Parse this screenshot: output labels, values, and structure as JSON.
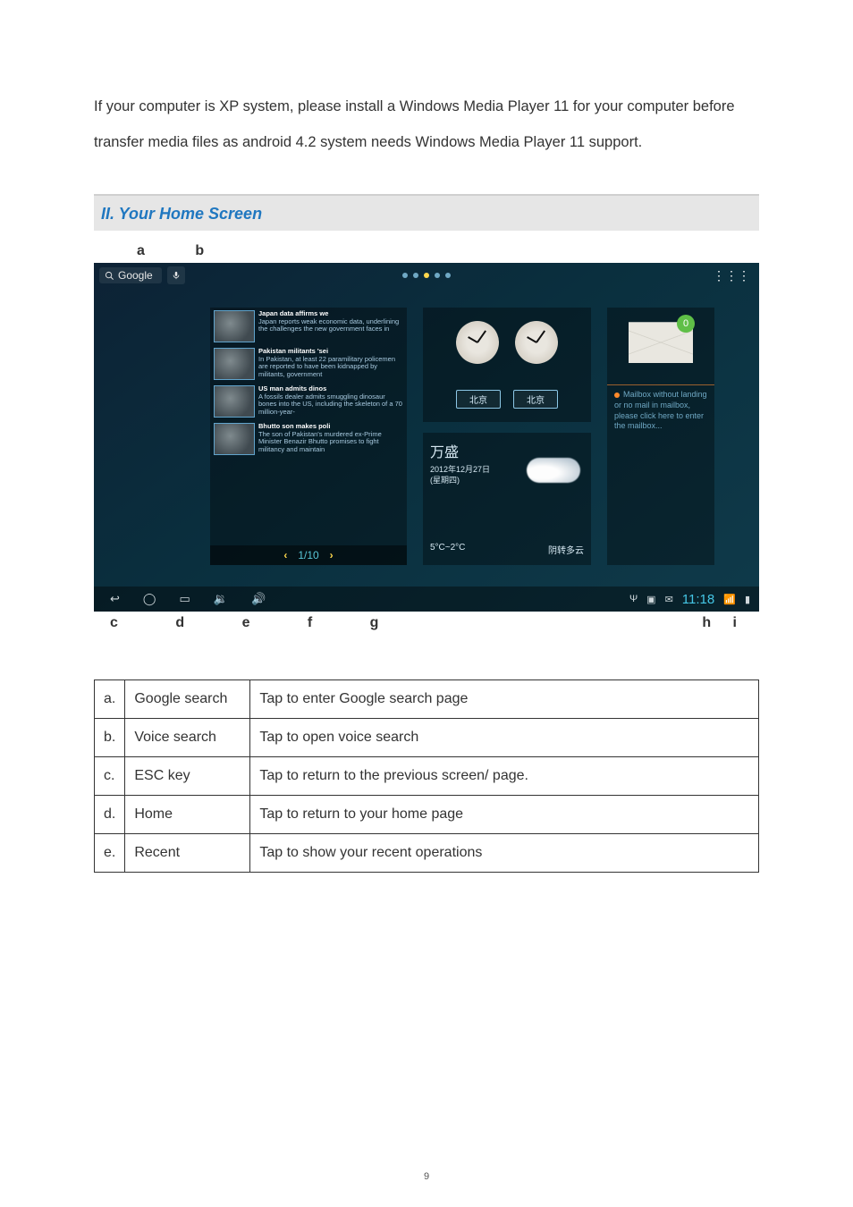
{
  "intro": "If your computer is XP system, please install a Windows Media Player 11 for your computer before transfer media files as android 4.2 system needs Windows Media Player 11 support.",
  "section_title": "II. Your Home Screen",
  "labels_top": {
    "a": "a",
    "b": "b"
  },
  "labels_bottom": "c   d   e   f   g",
  "labels_bottom_right": "h i",
  "topbar": {
    "search_label": "Google",
    "apps_glyph": "⋮⋮⋮"
  },
  "news": {
    "items": [
      {
        "headline": "Japan data affirms we",
        "body": "Japan reports weak economic data, underlining the challenges the new government faces in"
      },
      {
        "headline": "Pakistan militants 'sei",
        "body": "In Pakistan, at least 22 paramilitary policemen are reported to have been kidnapped by militants, government"
      },
      {
        "headline": "US man admits dinos",
        "body": "A fossils dealer admits smuggling dinosaur bones into the US, including the skeleton of a 70 million-year-"
      },
      {
        "headline": "Bhutto son makes poli",
        "body": "The son of Pakistan's murdered ex-Prime Minister Benazir Bhutto promises to fight militancy and maintain"
      }
    ],
    "pager": "1/10"
  },
  "clocks": {
    "city1": "北京",
    "city2": "北京"
  },
  "weather": {
    "location": "万盛",
    "date_line1": "2012年12月27日",
    "date_line2": "(星期四)",
    "temp": "5°C~2°C",
    "cond": "阴转多云"
  },
  "mail": {
    "badge": "0",
    "msg": "Mailbox without landing or no mail in mailbox, please click here to enter the mailbox..."
  },
  "sysbar": {
    "back": "↩",
    "home": "◯",
    "recent": "▭",
    "voldown": "🔉",
    "volup": "🔊",
    "usb": "Ψ",
    "pic": "▣",
    "wifi": "📶",
    "batt": "▮",
    "time": "11:18"
  },
  "legend": [
    {
      "k": "a.",
      "name": "Google search",
      "desc": "Tap to enter Google search page"
    },
    {
      "k": "b.",
      "name": "Voice search",
      "desc": "Tap to open voice search"
    },
    {
      "k": "c.",
      "name": "ESC key",
      "desc": "Tap to return to the previous screen/ page."
    },
    {
      "k": "d.",
      "name": "Home",
      "desc": "Tap to return to your home page"
    },
    {
      "k": "e.",
      "name": "Recent",
      "desc": "Tap to show your recent operations"
    }
  ],
  "page_number": "9"
}
